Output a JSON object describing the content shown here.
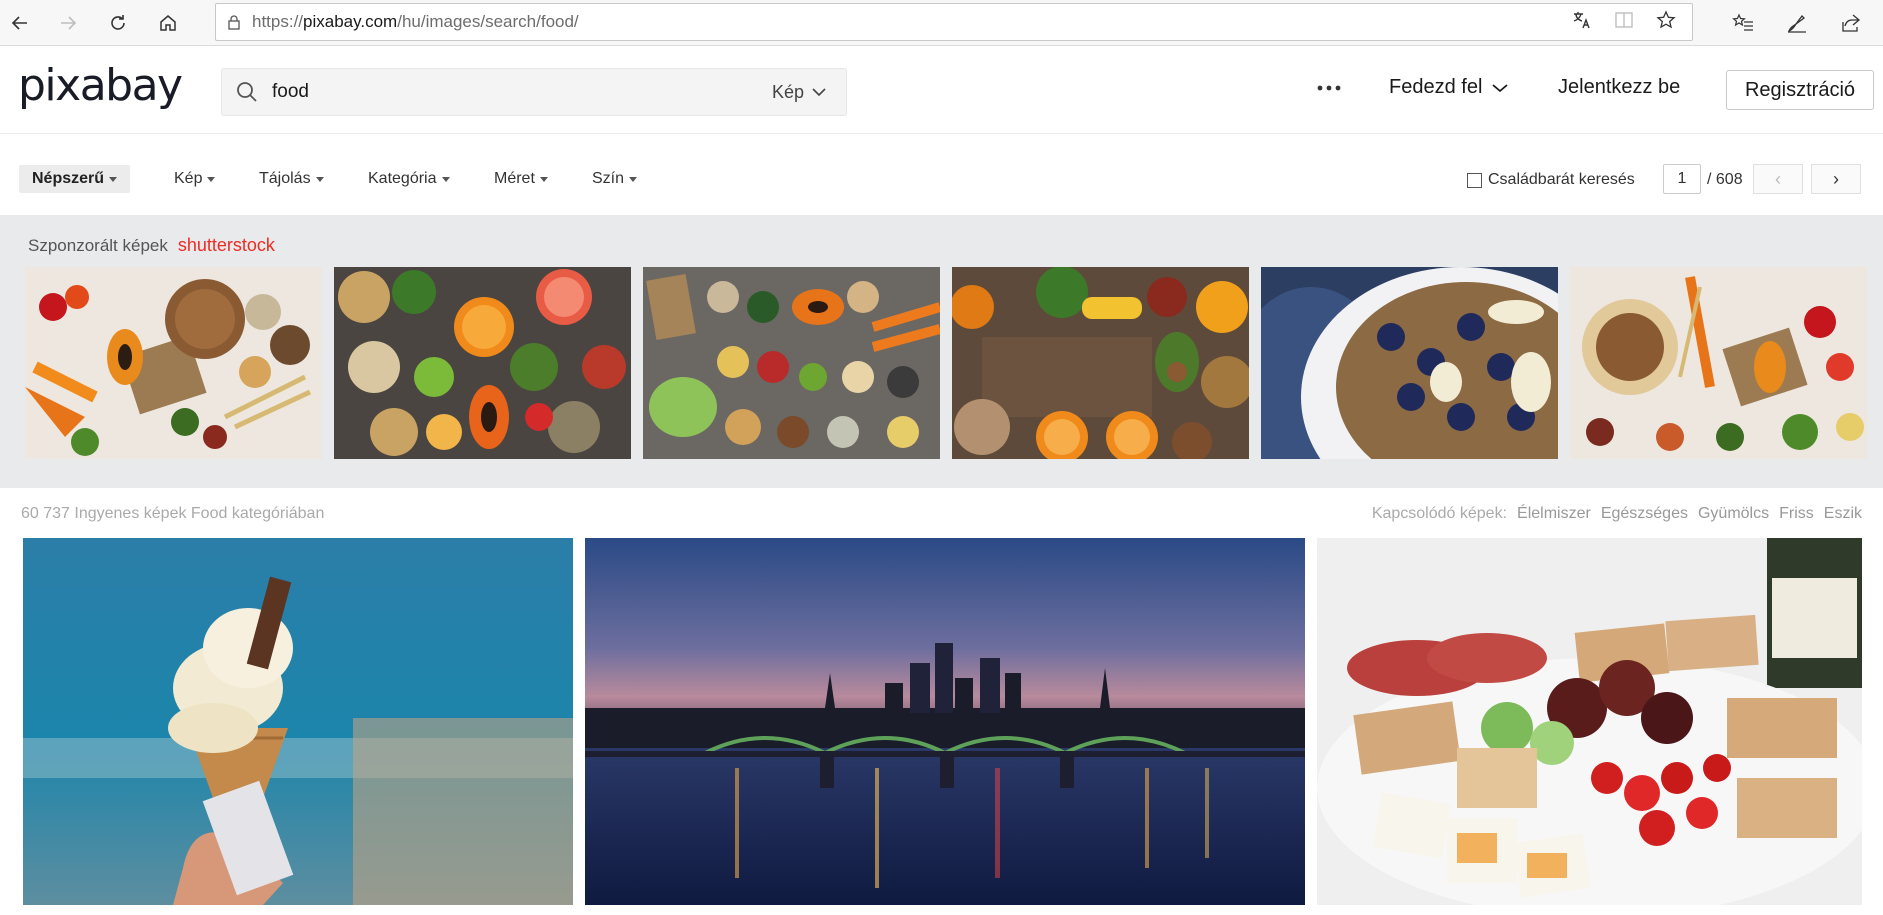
{
  "browser": {
    "url_prefix": "https://",
    "url_host": "pixabay.com",
    "url_path": "/hu/images/search/food/"
  },
  "header": {
    "logo": "pixabay",
    "search_value": "food",
    "search_type": "Kép",
    "explore": "Fedezd fel",
    "login": "Jelentkezz be",
    "register": "Regisztráció"
  },
  "filters": {
    "popular": "Népszerű",
    "image": "Kép",
    "orientation": "Tájolás",
    "category": "Kategória",
    "size": "Méret",
    "color": "Szín",
    "family_safe": "Családbarát keresés",
    "page_current": "1",
    "page_total": "/ 608"
  },
  "sponsored": {
    "title": "Szponzorált képek",
    "brand": "shutterstock"
  },
  "results": {
    "count_text": "60 737 Ingyenes képek Food kategóriában",
    "related_label": "Kapcsolódó képek:",
    "related_tags": [
      "Élelmiszer",
      "Egészséges",
      "Gyümölcs",
      "Friss",
      "Eszik"
    ]
  },
  "colors": {
    "accent": "#ee2b24",
    "sponsored_bg": "#e9eaeb"
  }
}
